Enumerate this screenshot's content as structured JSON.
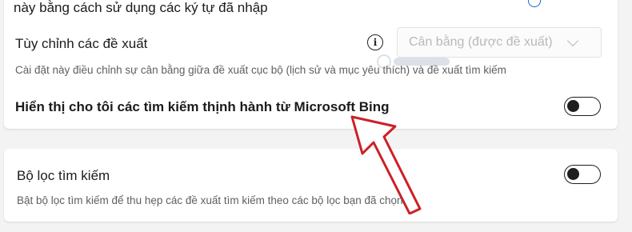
{
  "settings": {
    "partial_title": "này bằng cách sử dụng các ký tự đã nhập",
    "customize": {
      "title": "Tùy chỉnh các đề xuất",
      "select_value": "Cân bằng (được đề xuất)",
      "description": "Cài đặt này điều chỉnh sự cân bằng giữa đề xuất cục bộ (lịch sử và mục yêu thích) và đề xuất tìm kiếm"
    },
    "trending": {
      "title": "Hiển thị cho tôi các tìm kiếm thịnh hành từ Microsoft Bing",
      "enabled": false
    },
    "filter": {
      "title": "Bộ lọc tìm kiếm",
      "description": "Bật bộ lọc tìm kiếm để thu hẹp các đề xuất tìm kiếm theo các bộ lọc bạn đã chọn",
      "enabled": false
    }
  },
  "icons": {
    "info": "info-icon",
    "chevron": "chevron-down-icon",
    "annotation_arrow": "arrow-icon",
    "watermark_logo": "quantrimang-logo"
  },
  "colors": {
    "background": "#f3f3f3",
    "card": "#ffffff",
    "annotation_arrow": "#cc2026",
    "toggle_off": "#1e1e1e"
  }
}
